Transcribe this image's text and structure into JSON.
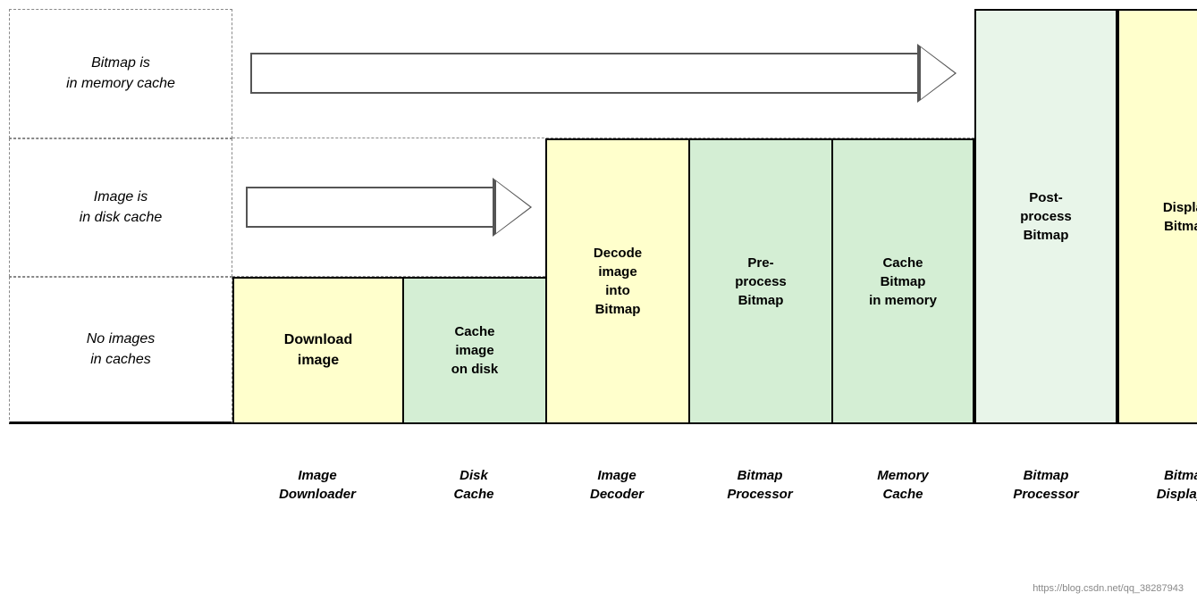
{
  "rows": {
    "row1_label": "Bitmap is\nin memory cache",
    "row2_label": "Image is\nin disk cache",
    "row3_label": "No images\nin caches"
  },
  "boxes": {
    "download_image": "Download\nimage",
    "cache_image_disk": "Cache\nimage\non disk",
    "decode_image": "Decode\nimage\ninto\nBitmap",
    "preprocess_bitmap": "Pre-\nprocess\nBitmap",
    "cache_bitmap_memory": "Cache\nBitmap\nin memory",
    "post_process_bitmap": "Post-\nprocess\nBitmap",
    "display_bitmap": "Display\nBitmap"
  },
  "footer_labels": {
    "image_downloader": "Image\nDownloader",
    "disk_cache": "Disk\nCache",
    "image_decoder": "Image\nDecoder",
    "bitmap_processor_1": "Bitmap\nProcessor",
    "memory_cache": "Memory\nCache",
    "bitmap_processor_2": "Bitmap\nProcessor",
    "bitmap_displayer": "Bitmap\nDisplayer"
  },
  "watermark": "https://blog.csdn.net/qq_38287943"
}
